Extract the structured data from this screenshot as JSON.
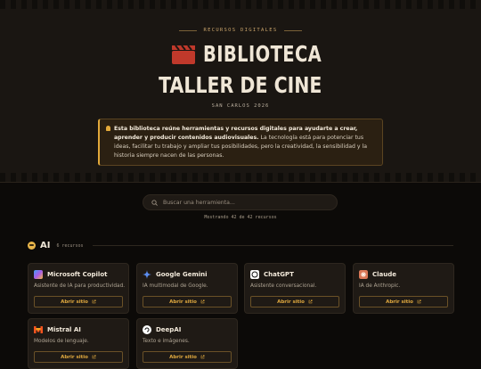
{
  "hero": {
    "kicker": "RECURSOS DIGITALES",
    "title_line1": "BIBLIOTECA",
    "title_line2": "TALLER DE CINE",
    "location": "SAN CARLOS 2026",
    "notice_bold": "Esta biblioteca reúne herramientas y recursos digitales para ayudarte a crear, aprender y producir contenidos audiovisuales.",
    "notice_text": " La tecnología está para potenciar tus ideas, facilitar tu trabajo y ampliar tus posibilidades, pero la creatividad, la sensibilidad y la historia siempre nacen de las personas."
  },
  "search": {
    "placeholder": "Buscar una herramienta...",
    "value": ""
  },
  "results_count": "Mostrando 42 de 42 recursos",
  "section": {
    "name": "AI",
    "count": "6 recursos"
  },
  "cards": [
    {
      "name": "Microsoft Copilot",
      "desc": "Asistente de IA para productividad.",
      "button": "Abrir sitio",
      "icon": "copilot-icon",
      "color": "#4a8cf0"
    },
    {
      "name": "Google Gemini",
      "desc": "IA multimodal de Google.",
      "button": "Abrir sitio",
      "icon": "gemini-icon",
      "color": "#5b8def"
    },
    {
      "name": "ChatGPT",
      "desc": "Asistente conversacional.",
      "button": "Abrir sitio",
      "icon": "chatgpt-icon",
      "color": "#ffffff"
    },
    {
      "name": "Claude",
      "desc": "IA de Anthropic.",
      "button": "Abrir sitio",
      "icon": "claude-icon",
      "color": "#d97757"
    },
    {
      "name": "Mistral AI",
      "desc": "Modelos de lenguaje.",
      "button": "Abrir sitio",
      "icon": "mistral-icon",
      "color": "#f7541f"
    },
    {
      "name": "DeepAI",
      "desc": "Texto e imágenes.",
      "button": "Abrir sitio",
      "icon": "deepai-icon",
      "color": "#ffffff"
    }
  ],
  "colors": {
    "accent": "#e2a93a",
    "background": "#0c0a08",
    "card": "#1f1a15",
    "clapperboard": "#c0392b"
  }
}
